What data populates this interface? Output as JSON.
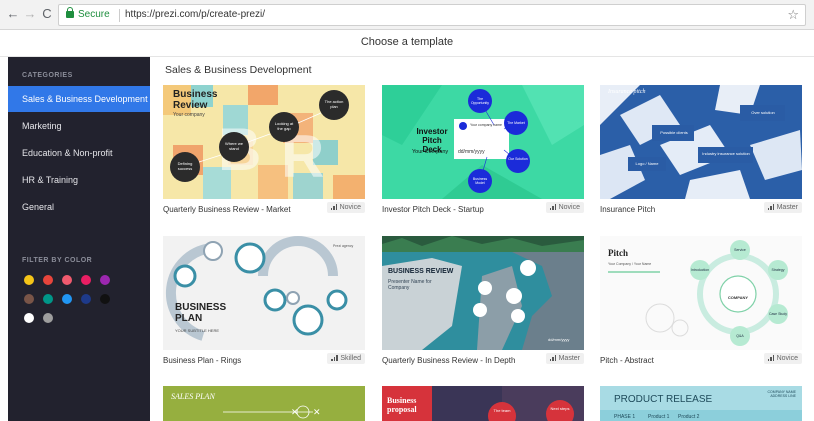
{
  "browser": {
    "secure_label": "Secure",
    "url": "https://prezi.com/p/create-prezi/"
  },
  "header": {
    "title": "Choose a template"
  },
  "sidebar": {
    "categories_label": "CATEGORIES",
    "items": [
      {
        "label": "Sales & Business Development"
      },
      {
        "label": "Marketing"
      },
      {
        "label": "Education & Non-profit"
      },
      {
        "label": "HR & Training"
      },
      {
        "label": "General"
      }
    ],
    "filter_label": "FILTER BY COLOR",
    "colors": [
      "#f5c518",
      "#e8453c",
      "#f05a6e",
      "#e91e63",
      "#9c27b0",
      "#795548",
      "#009688",
      "#2196f3",
      "#1e3a8a",
      "#111111",
      "#ffffff",
      "#9e9e9e"
    ]
  },
  "main": {
    "section_title": "Sales & Business Development",
    "templates": [
      {
        "name": "Quarterly Business Review - Market",
        "level": "Novice",
        "thumb": {
          "title": "Business Review",
          "subtitle": "Your company",
          "bubbles": [
            "The action plan",
            "Looking at the gap",
            "Where we stand",
            "Defining success"
          ]
        }
      },
      {
        "name": "Investor Pitch Deck - Startup",
        "level": "Novice",
        "thumb": {
          "title": "Investor Pitch Deck",
          "subtitle": "Your Company",
          "date": "dd/mm/yyyy",
          "logo_text": "Your company name",
          "bubbles": [
            "The Opportunity",
            "The Market",
            "Our Solution",
            "Business Model"
          ]
        }
      },
      {
        "name": "Insurance Pitch",
        "level": "Master",
        "thumb": {
          "title": "Insurance pitch",
          "labels": [
            "Possible clients",
            "Over solution",
            "Industry insurance solution"
          ],
          "logo_text": "Logo / Name"
        }
      },
      {
        "name": "Business Plan - Rings",
        "level": "Skilled",
        "thumb": {
          "title": "BUSINESS PLAN",
          "subtitle": "YOUR SUBTITLE HERE",
          "logo_text": "Prezi agency"
        }
      },
      {
        "name": "Quarterly Business Review - In Depth",
        "level": "Master",
        "thumb": {
          "title": "BUSINESS REVIEW",
          "subtitle": "Presenter Name for Company",
          "date": "dd/mm/yyyy"
        }
      },
      {
        "name": "Pitch - Abstract",
        "level": "Novice",
        "thumb": {
          "title": "Pitch",
          "subtitle": "Your Company / Your Name",
          "center": "COMPANY",
          "nodes": [
            "Service",
            "Strategy",
            "Case Study",
            "Q&A",
            "Introduction"
          ]
        }
      },
      {
        "name": "",
        "level": "",
        "thumb": {
          "title": "SALES PLAN"
        }
      },
      {
        "name": "",
        "level": "",
        "thumb": {
          "title": "Business proposal",
          "labels": [
            "The team",
            "Next steps"
          ]
        }
      },
      {
        "name": "",
        "level": "",
        "thumb": {
          "title": "PRODUCT RELEASE",
          "labels": [
            "PHASE 1",
            "Product 1",
            "Product 2",
            "COMPANY NAME ADDRESS LINE"
          ]
        }
      }
    ]
  }
}
